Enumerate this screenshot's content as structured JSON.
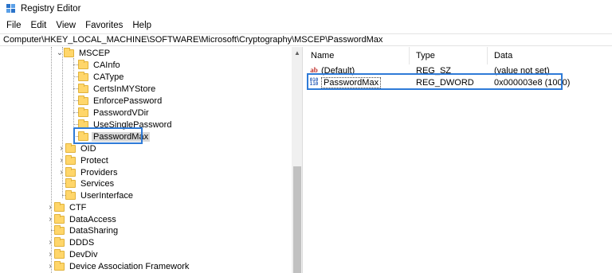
{
  "window": {
    "title": "Registry Editor"
  },
  "menu": [
    "File",
    "Edit",
    "View",
    "Favorites",
    "Help"
  ],
  "address": "Computer\\HKEY_LOCAL_MACHINE\\SOFTWARE\\Microsoft\\Cryptography\\MSCEP\\PasswordMax",
  "tree": {
    "mscep": "MSCEP",
    "mscep_children": [
      "CAInfo",
      "CAType",
      "CertsInMYStore",
      "EnforcePassword",
      "PasswordVDir",
      "UseSinglePassword",
      "PasswordMax"
    ],
    "siblings": [
      "OID",
      "Protect",
      "Providers",
      "Services",
      "UserInterface"
    ],
    "top_level": [
      "CTF",
      "DataAccess",
      "DataSharing",
      "DDDS",
      "DevDiv",
      "Device Association Framework"
    ]
  },
  "list": {
    "headers": {
      "name": "Name",
      "type": "Type",
      "data": "Data"
    },
    "rows": [
      {
        "name": "(Default)",
        "type": "REG_SZ",
        "data": "(value not set)",
        "icon": "string-value-icon"
      },
      {
        "name": "PasswordMax",
        "type": "REG_DWORD",
        "data": "0x000003e8 (1000)",
        "icon": "dword-value-icon"
      }
    ]
  },
  "colors": {
    "highlight_border": "#2f7bd8",
    "folder": "#ffd66a"
  }
}
